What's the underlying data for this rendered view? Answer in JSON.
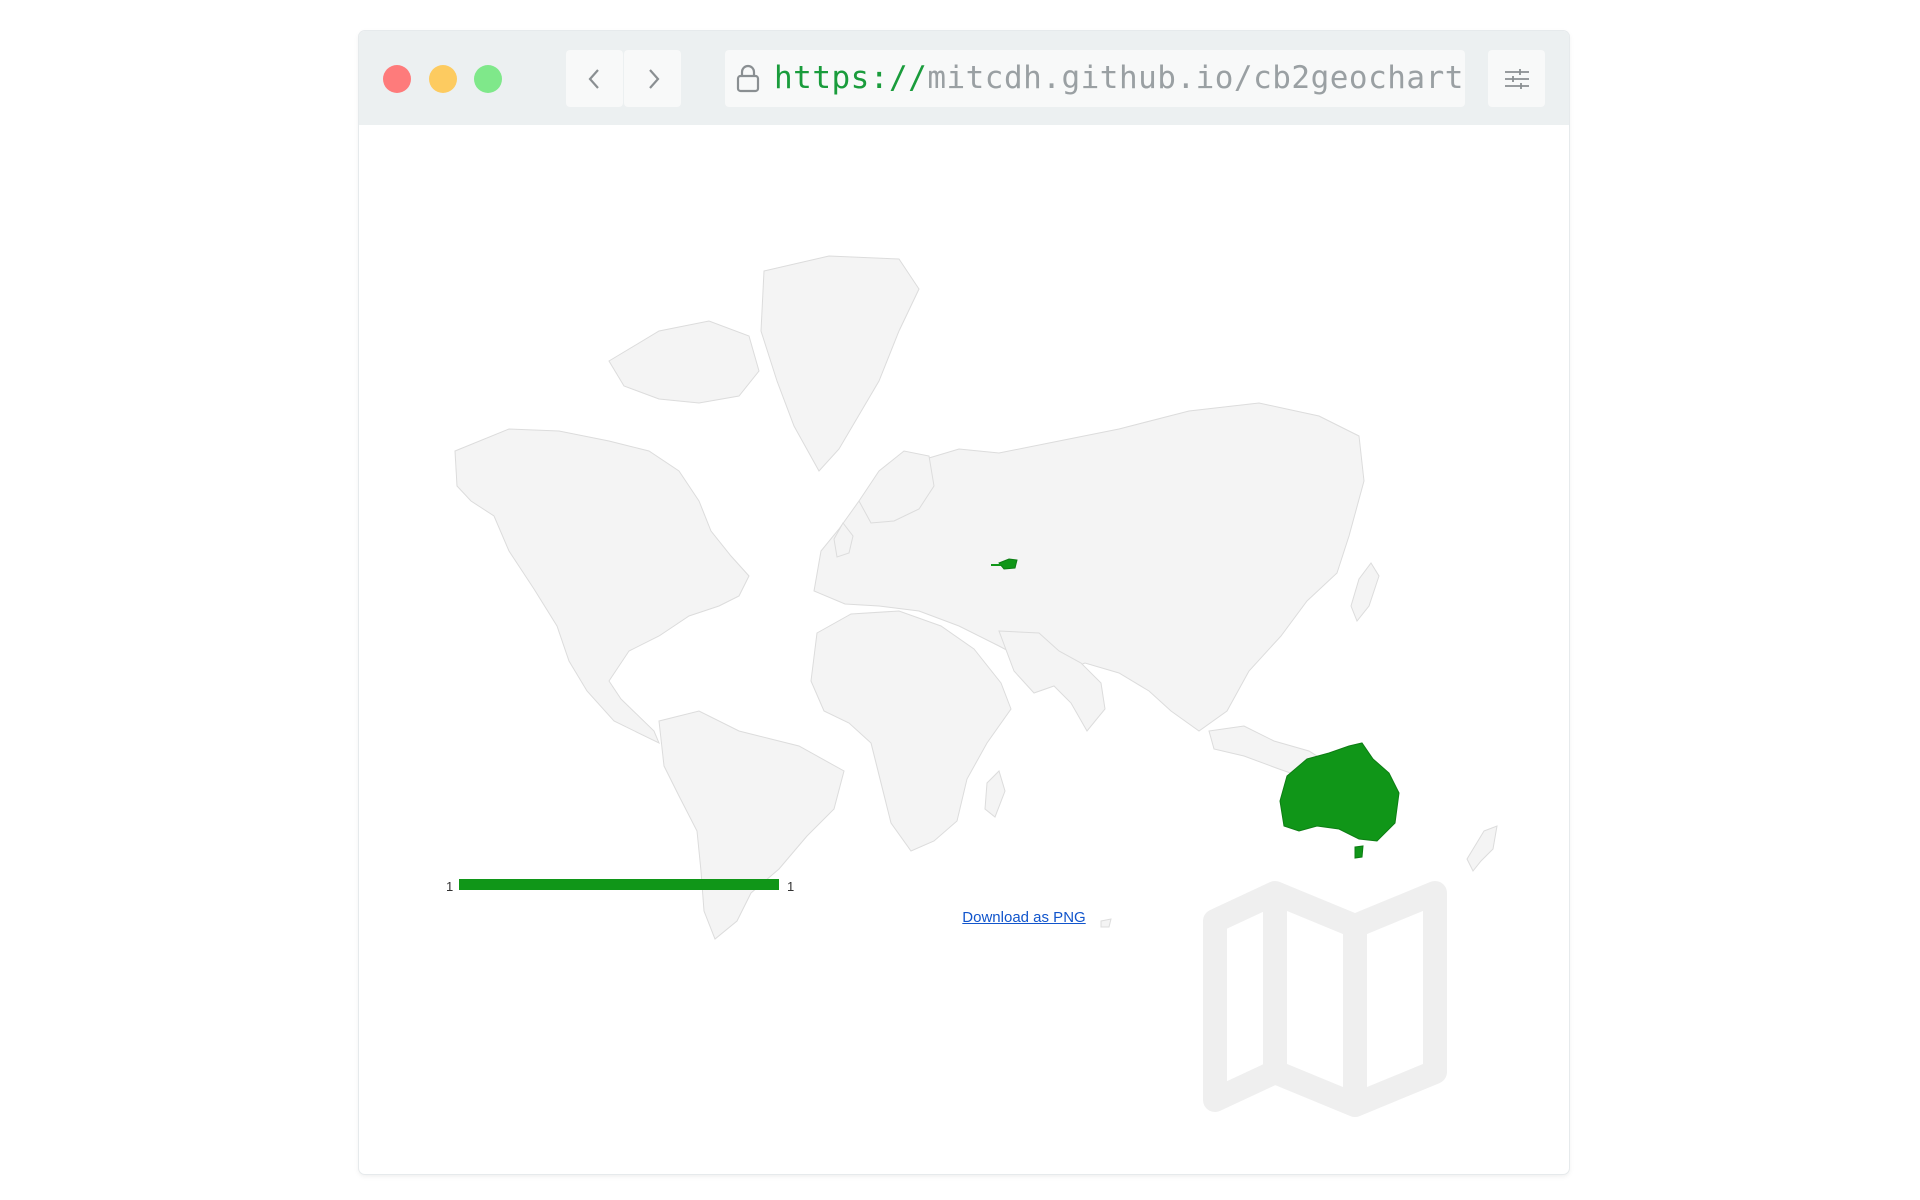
{
  "browser": {
    "url_scheme": "https://",
    "url_rest": "mitcdh.github.io/cb2geochart/"
  },
  "icons": {
    "back": "chevron-left-icon",
    "forward": "chevron-right-icon",
    "lock": "lock-icon",
    "settings": "sliders-icon",
    "watermark": "folded-map-icon"
  },
  "colors": {
    "close": "#fe7b7b",
    "minimize": "#fdcb60",
    "maximize": "#7fe88a",
    "highlight": "#109618",
    "land": "#f4f4f4",
    "link": "#1155cc"
  },
  "chart": {
    "highlighted_regions": [
      "Australia",
      "Austria"
    ],
    "legend": {
      "min_label": "1",
      "max_label": "1"
    },
    "download_label": "Download as PNG"
  }
}
